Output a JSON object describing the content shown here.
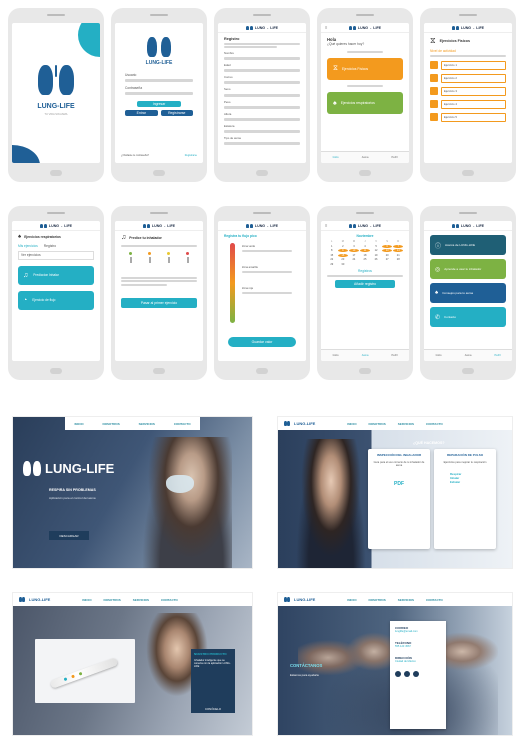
{
  "brand": {
    "logo_lung": "LUNG",
    "logo_life": "LIFE",
    "logo_dash": "-",
    "tagline": "TU VIDA SIN ASMA",
    "colors": {
      "teal": "#24afc4",
      "orange": "#f39a1e",
      "green": "#7db243",
      "navy": "#1f3d5c",
      "blue": "#1f5f96"
    }
  },
  "app": {
    "login": {
      "title": "LUNG-LIFE",
      "user_label": "Usuario",
      "pass_label": "Contraseña",
      "login_btn": "Ingresar",
      "btn_left": "Entrar",
      "btn_right": "Registrarse",
      "forgot": "¿Olvidaste tu contraseña?",
      "register": "Registrarse"
    },
    "register": {
      "title": "Registro",
      "fields": [
        "Nombre",
        "Edad",
        "Correo",
        "Sexo",
        "Peso",
        "Altura",
        "Estatura",
        "Tipo de asma"
      ]
    },
    "home": {
      "greeting": "Hola",
      "subtitle": "¿Qué quieres hacer hoy?",
      "card_physical": "Ejercicios Físicos",
      "card_respiratory": "Ejercicios respiratorios",
      "tabs": [
        "Inicio",
        "Asma",
        "Perfil"
      ]
    },
    "physical": {
      "title": "Ejercicios Físicos",
      "level": "Nivel de actividad",
      "items": [
        "Ejercicio 1",
        "Ejercicio 2",
        "Ejercicio 3",
        "Ejercicio 4",
        "Ejercicio 5"
      ]
    },
    "respiratory": {
      "title": "Ejercicios respiratorios",
      "tabs": [
        "Mis ejercicios",
        "Registro"
      ],
      "btn_music": "Prediccion Inhalar",
      "btn_vibrate": "Ejercicio de flujo",
      "label": "Ver ejercicios"
    },
    "predict": {
      "title": "Predice tu inhalador",
      "cta": "Pasar al primer ejercicio"
    },
    "flow": {
      "title": "Registra tu flujo pico",
      "scale": [
        "Zona verde",
        "Zona amarilla",
        "Zona roja"
      ],
      "cta": "Guardar valor"
    },
    "calendar": {
      "month": "Noviembre",
      "days": [
        "L",
        "M",
        "M",
        "J",
        "V",
        "S",
        "D"
      ],
      "cta": "Añadir registro",
      "sub": "Registros"
    },
    "menu": {
      "items": [
        "Acerca de LUNG-LIFE",
        "Aprende a usar tu inhalador",
        "Consejos para tu asma",
        "Contacto"
      ],
      "tabs": [
        "Inicio",
        "Asma",
        "Perfil"
      ]
    }
  },
  "web": {
    "nav": [
      "INICIO",
      "NOSOTROS",
      "SERVICIOS",
      "CONTACTO"
    ],
    "hero": {
      "subtitle": "RESPIRA SIN PROBLEMAS",
      "text": "Aplicación para el control del asma",
      "cta": "DESCARGAR"
    },
    "services": {
      "heading": "¿QUÉ HACEMOS?",
      "card1_title": "INSPECCIÓN DEL INHALADOR",
      "card1_body": "Guía para el uso correcto de tu inhalador de asma",
      "card1_link": "PDF",
      "card2_title": "REPARACIÓN DE PULSO",
      "card2_body": "Ejercicios para mejorar tu respiración",
      "card2_items": [
        "Respirar",
        "Inhalar",
        "Exhalar"
      ]
    },
    "product": {
      "heading": "NUESTRO PRODUCTO",
      "text": "Inhalador inteligente que se conecta con la aplicación LUNG-LIFE",
      "cta": "CONÓCELO"
    },
    "contact": {
      "heading": "CONTÁCTANOS",
      "text": "Estamos para ayudarte",
      "items": [
        {
          "label": "CORREO",
          "value": "lunglife@email.com"
        },
        {
          "label": "TELÉFONO",
          "value": "555 123 4567"
        },
        {
          "label": "DIRECCIÓN",
          "value": "Ciudad de México"
        }
      ]
    }
  }
}
